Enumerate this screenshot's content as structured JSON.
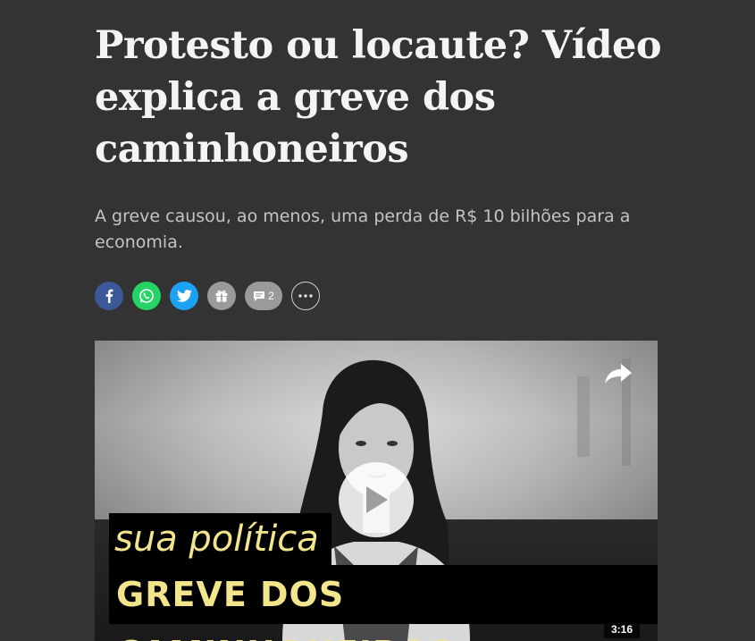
{
  "article": {
    "headline": "Protesto ou locaute? Vídeo explica a greve dos caminhoneiros",
    "dek": "A greve causou, ao menos, uma perda de R$ 10 bilhões para a economia."
  },
  "share": {
    "buttons": [
      {
        "name": "facebook",
        "icon": "facebook-icon",
        "color": "#3b5998"
      },
      {
        "name": "whatsapp",
        "icon": "whatsapp-icon",
        "color": "#25d366"
      },
      {
        "name": "twitter",
        "icon": "twitter-icon",
        "color": "#1da1f2"
      },
      {
        "name": "gift",
        "icon": "gift-icon",
        "color": "#9a9a9a"
      },
      {
        "name": "comments",
        "icon": "comment-icon",
        "color": "#9a9a9a"
      },
      {
        "name": "more",
        "icon": "more-dots-icon",
        "color": "#cfcfcf"
      }
    ],
    "comment_count": "2"
  },
  "video": {
    "caption_line1": "sua política",
    "caption_line2": "GREVE DOS CAMINHONEIROS",
    "duration": "3:16",
    "caption_color": "#f2e58c"
  }
}
